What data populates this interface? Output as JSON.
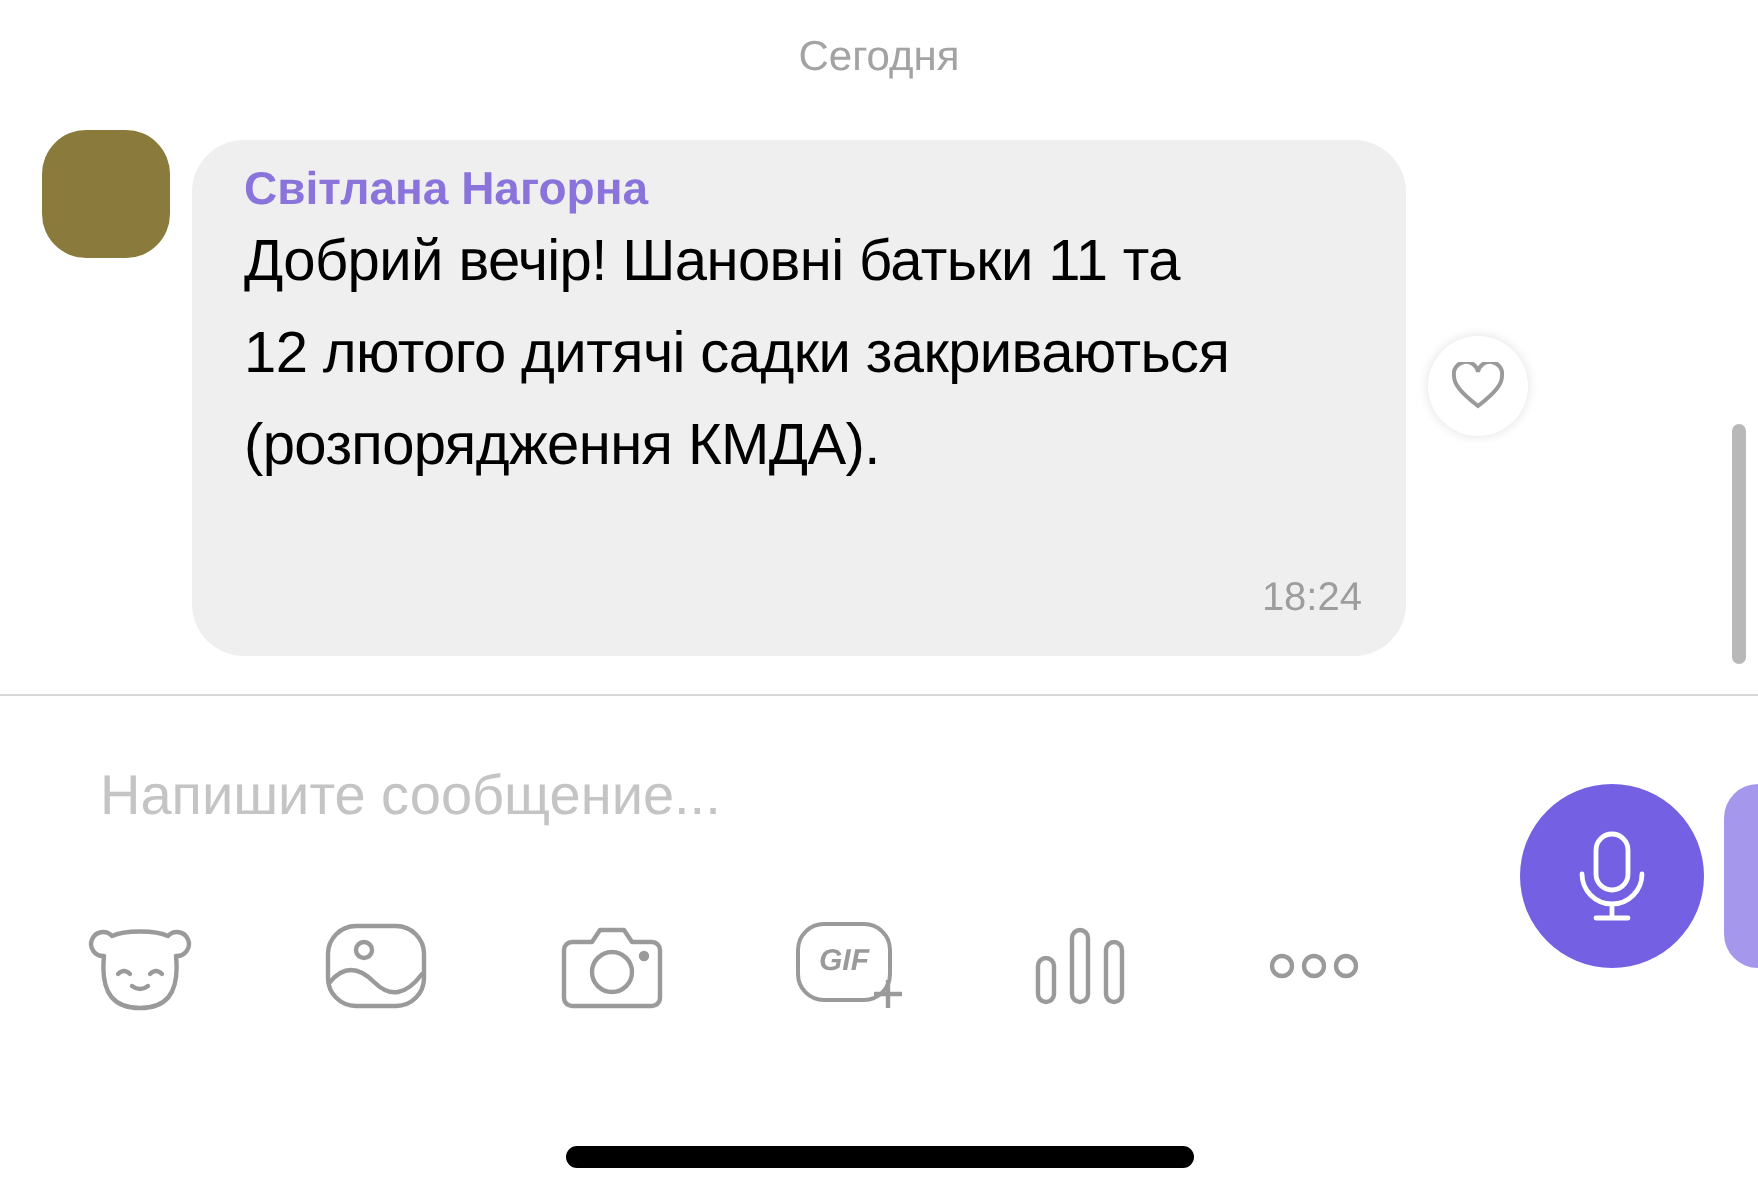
{
  "date_divider": "Сегодня",
  "message": {
    "sender": "Світлана Нагорна",
    "text": "Добрий вечір! Шановні батьки 11 та 12 лютого дитячі садки закриваються (розпорядження КМДА).",
    "time": "18:24",
    "liked": false
  },
  "composer": {
    "placeholder": "Напишите сообщение..."
  },
  "toolbar": [
    {
      "kind": "sticker"
    },
    {
      "kind": "gallery"
    },
    {
      "kind": "camera"
    },
    {
      "kind": "gif",
      "label": "GIF"
    },
    {
      "kind": "poll"
    },
    {
      "kind": "more"
    }
  ]
}
